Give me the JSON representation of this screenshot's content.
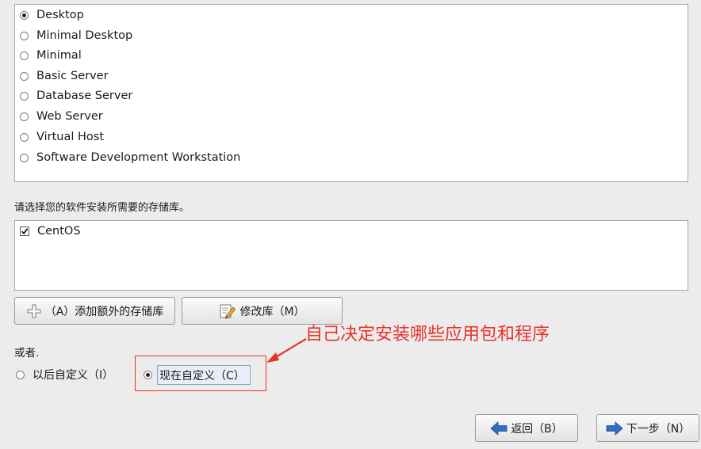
{
  "package_groups": [
    {
      "label": "Desktop",
      "selected": true
    },
    {
      "label": "Minimal Desktop",
      "selected": false
    },
    {
      "label": "Minimal",
      "selected": false
    },
    {
      "label": "Basic Server",
      "selected": false
    },
    {
      "label": "Database Server",
      "selected": false
    },
    {
      "label": "Web Server",
      "selected": false
    },
    {
      "label": "Virtual Host",
      "selected": false
    },
    {
      "label": "Software Development Workstation",
      "selected": false
    }
  ],
  "repo_prompt": "请选择您的软件安装所需要的存储库。",
  "repositories": [
    {
      "label": "CentOS",
      "checked": true
    }
  ],
  "buttons": {
    "add_repo": "（A）添加额外的存储库",
    "modify_repo": "修改库（M）",
    "back": "返回（B）",
    "next": "下一步（N）"
  },
  "or_label": "或者.",
  "customize": {
    "later": "以后自定义（I）",
    "now": "现在自定义（C）",
    "selected": "now"
  },
  "annotation": {
    "text": "自己决定安装哪些应用包和程序",
    "color": "#e8332a"
  }
}
